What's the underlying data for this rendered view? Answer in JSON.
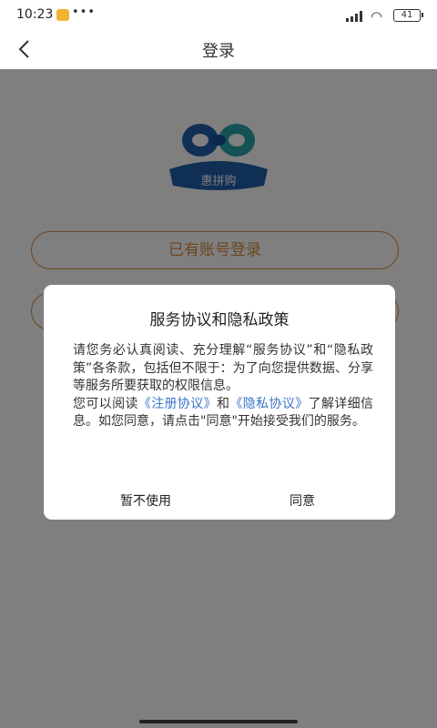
{
  "status_bar": {
    "time": "10:23",
    "dots": "•••",
    "battery": "41"
  },
  "nav": {
    "title": "登录"
  },
  "logo": {
    "text": "惠拼购"
  },
  "buttons": {
    "login_existing": "已有账号登录",
    "second": ""
  },
  "dialog": {
    "title": "服务协议和隐私政策",
    "intro": "请您务必认真阅读、充分理解“服务协议”和“隐私政策”各条款，包括但不限于：为了向您提供数据、分享等服务所要获取的权限信息。",
    "read_prefix": "您可以阅读",
    "link_register": "《注册协议》",
    "and": "和",
    "link_privacy": "《隐私协议》",
    "read_suffix": "了解详细信息。如您同意，请点击\"同意\"开始接受我们的服务。",
    "decline": "暂不使用",
    "agree": "同意"
  },
  "colors": {
    "accent": "#d98a3c",
    "link": "#3a74c9",
    "logo_blue": "#1f5eab",
    "logo_teal": "#2aa5a8"
  }
}
